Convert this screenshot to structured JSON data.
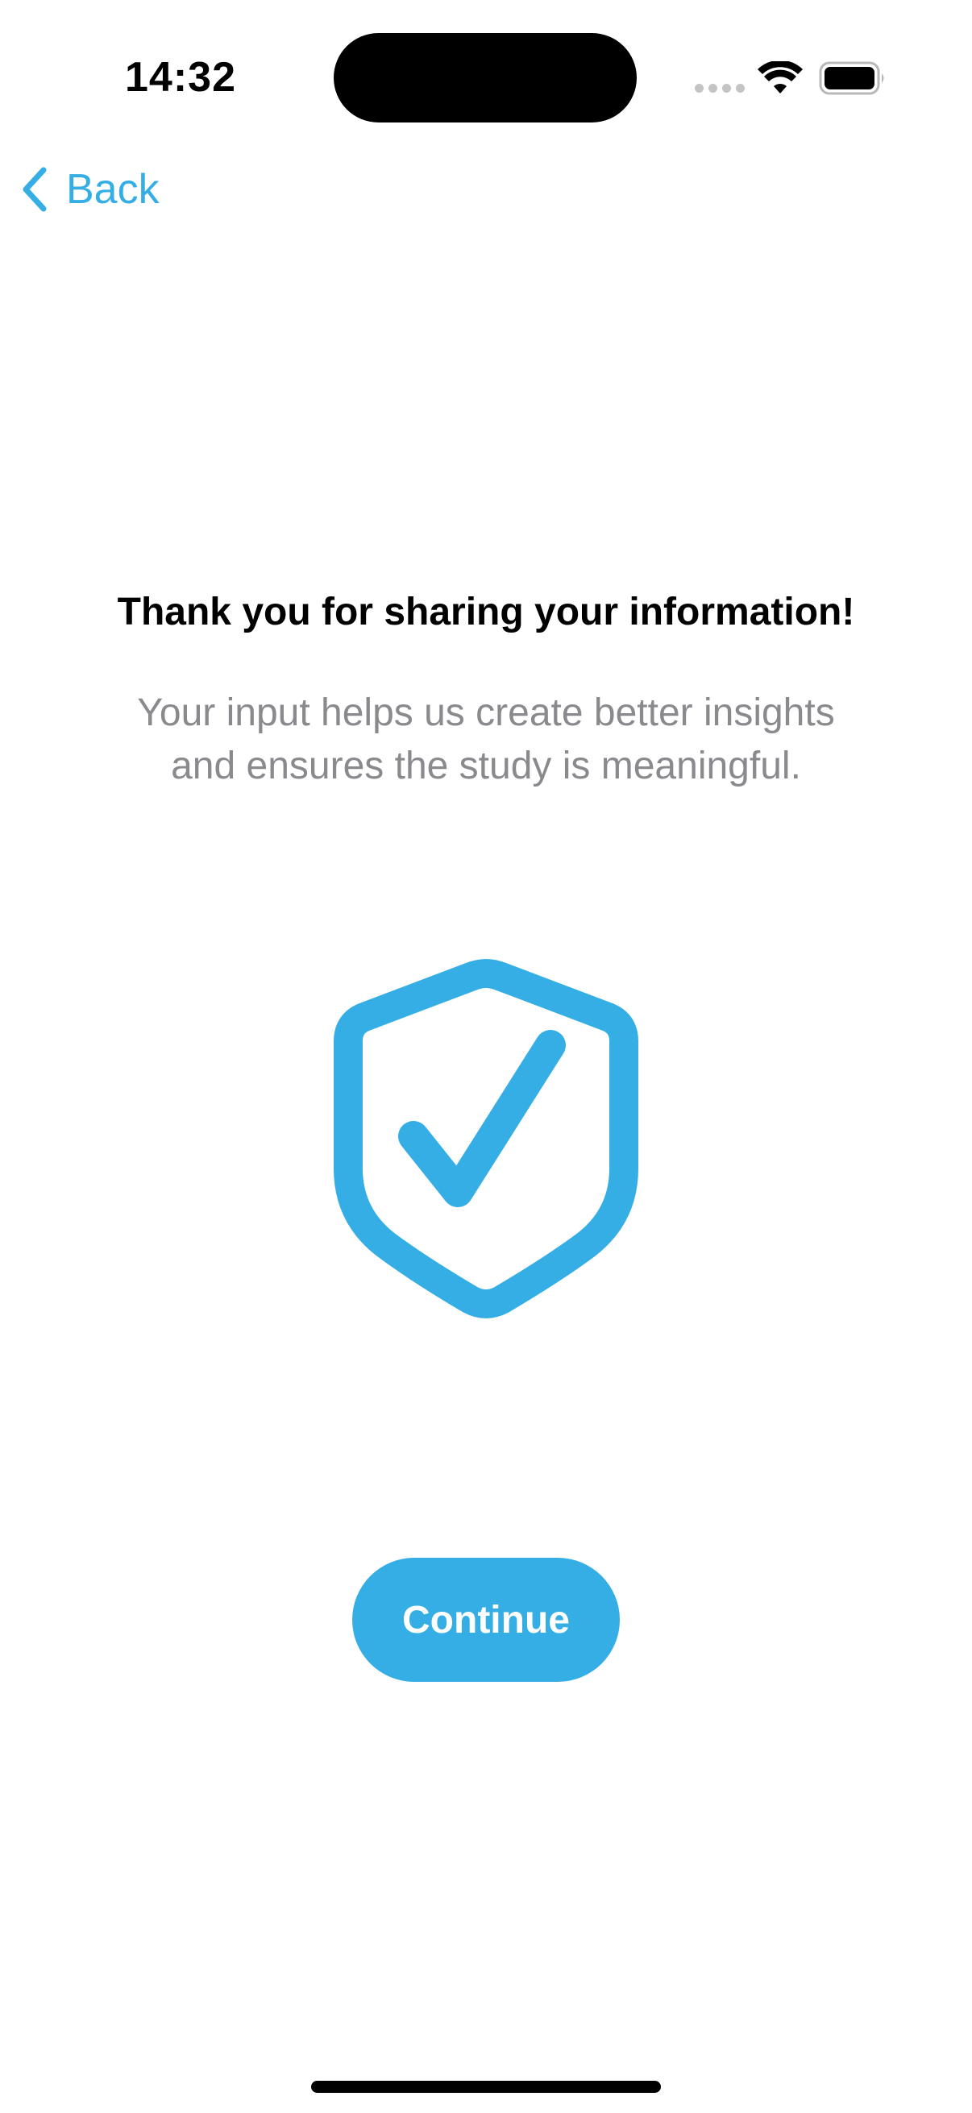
{
  "status_bar": {
    "time": "14:32"
  },
  "nav": {
    "back_label": "Back"
  },
  "content": {
    "title": "Thank you for sharing your information!",
    "subtitle_lines": [
      "Your input helps us create better insights",
      "and ensures the study is meaningful."
    ],
    "icon": "shield-check-icon"
  },
  "actions": {
    "continue_label": "Continue"
  },
  "colors": {
    "accent": "#35aee6",
    "subtitle": "#8a8a8e",
    "text": "#000000",
    "background": "#ffffff"
  }
}
